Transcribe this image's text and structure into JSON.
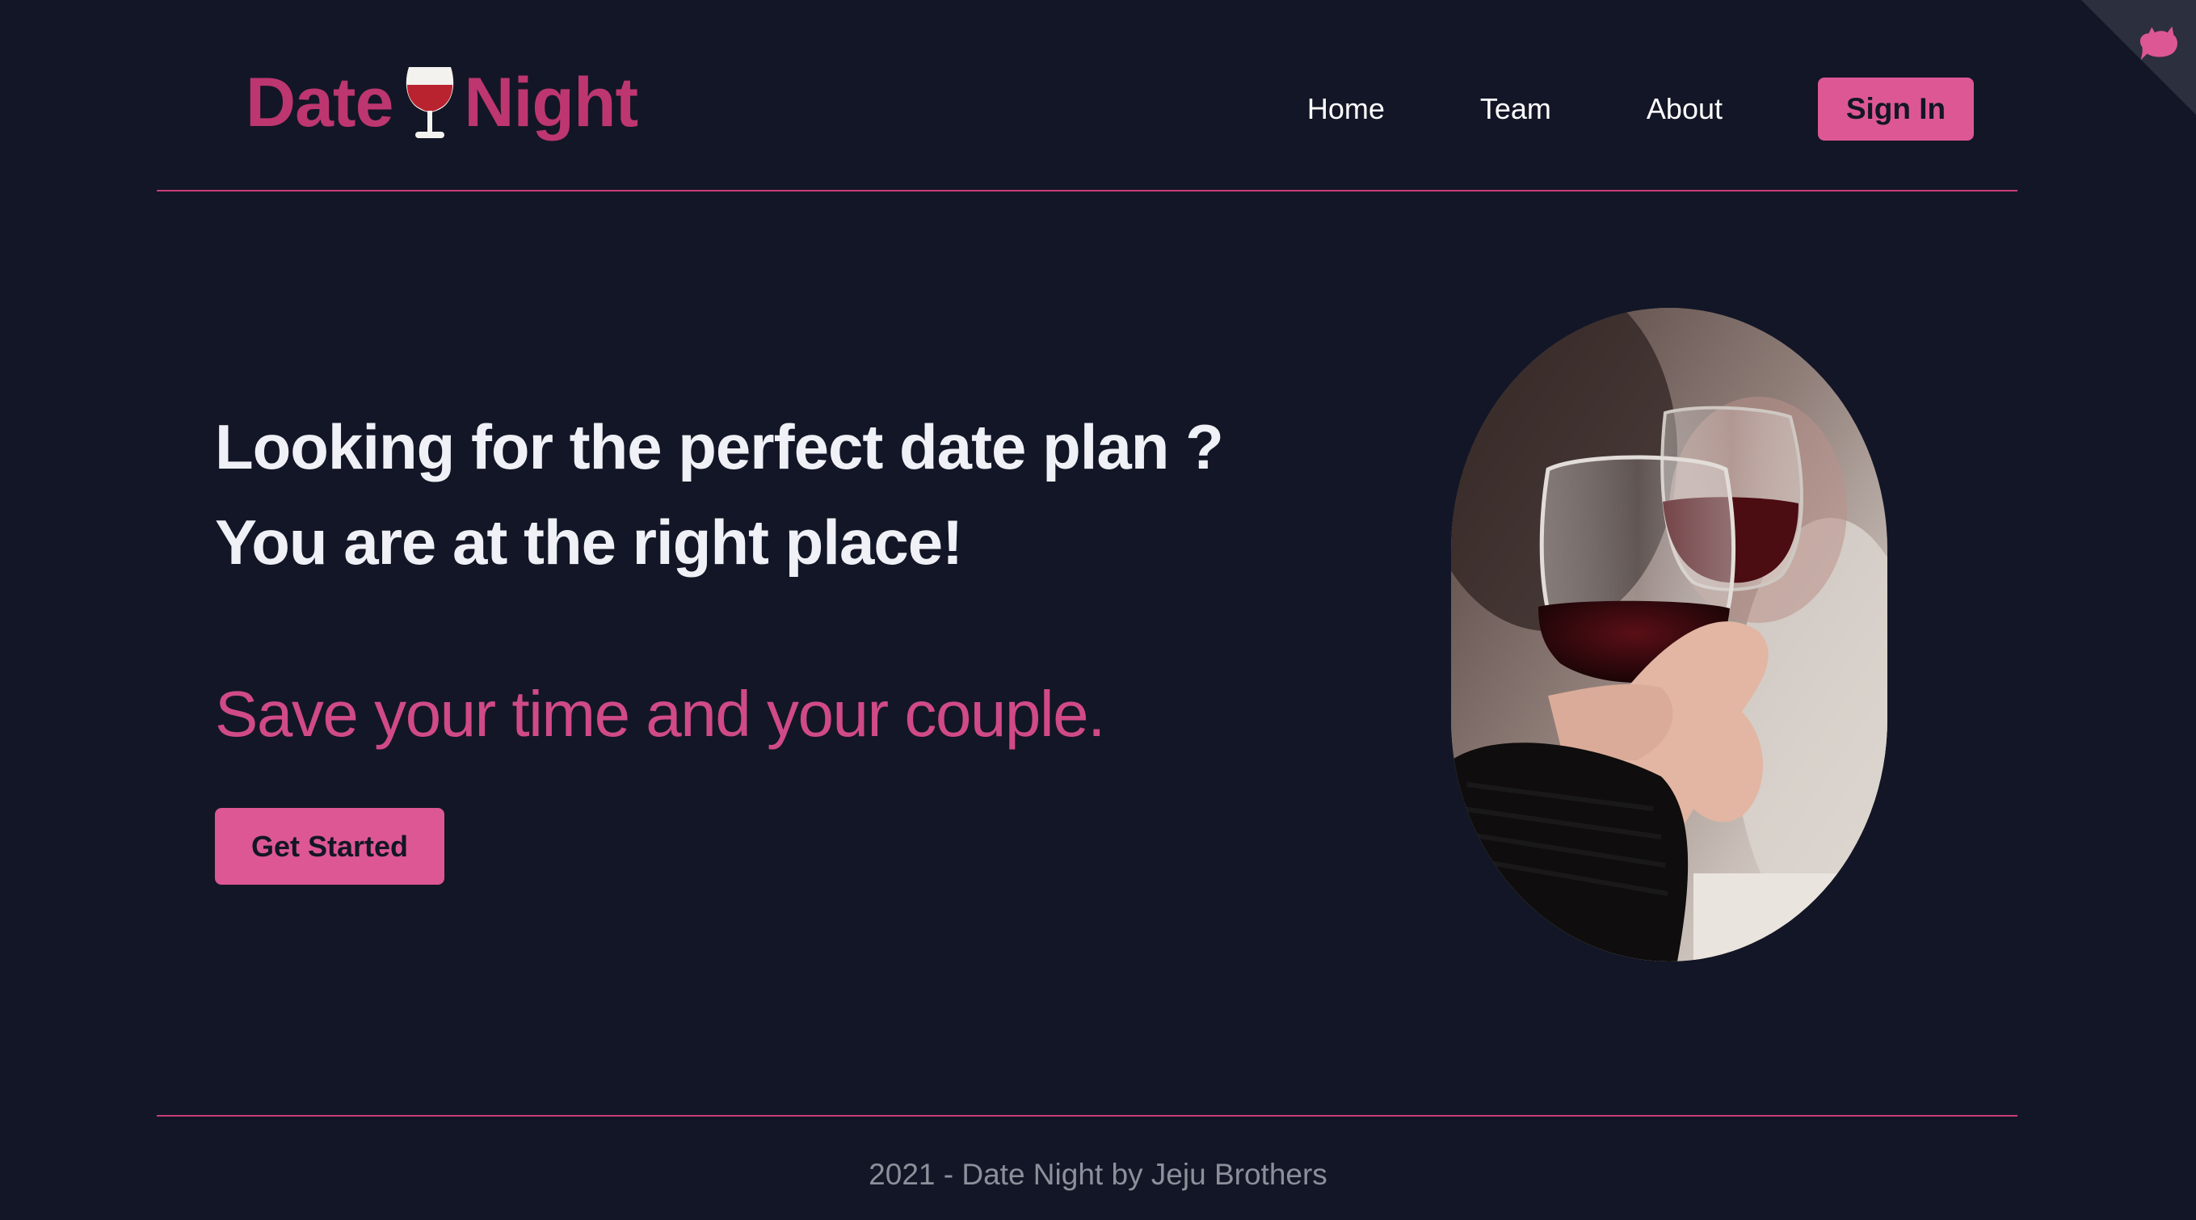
{
  "header": {
    "logo_left": "Date",
    "logo_right": "Night",
    "nav": [
      {
        "label": "Home"
      },
      {
        "label": "Team"
      },
      {
        "label": "About"
      }
    ],
    "signin_label": "Sign In"
  },
  "hero": {
    "headline_line1": "Looking for the perfect date plan ?",
    "headline_line2": "You are at the right place!",
    "tagline": "Save your time and your couple.",
    "cta_label": "Get Started",
    "photo_icon": "wine-toast-photo"
  },
  "corner": {
    "icon": "cat-icon"
  },
  "footer": {
    "text": "2021 - Date Night by Jeju Brothers"
  },
  "colors": {
    "background": "#131626",
    "accent": "#dd5795",
    "brand": "#bd3670",
    "headline": "#eff1f6",
    "footer_text": "#8d909b"
  }
}
